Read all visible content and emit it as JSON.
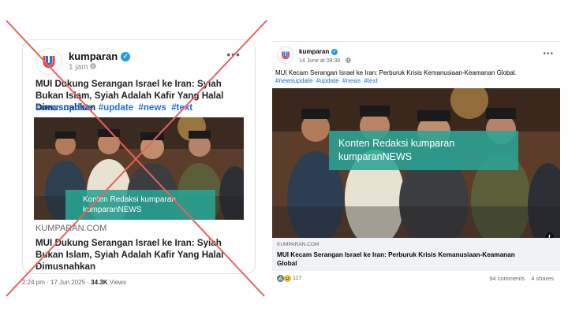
{
  "fake_post": {
    "account": "kumparan",
    "time": "1 jam",
    "headline": "MUI Dukung Serangan Israel ke Iran: Syiah Bukan Islam, Syiah Adalah Kafir Yang Halal Dimusnahkan",
    "hashtags": [
      "#newsupdate",
      "#update",
      "#news",
      "#text"
    ],
    "overlay_line1": "Konten Redaksi kumparan",
    "overlay_line2": "kumparanNEWS",
    "link_domain": "KUMPARAN.COM",
    "link_title": "MUI Dukung Serangan Israel ke Iran: Syiah Bukan Islam, Syiah Adalah Kafir Yang Halal Dimusnahkan",
    "footer_time": "2:24 pm · 17 Jun 2025 · ",
    "footer_views": "34.3K",
    "footer_views_label": " Views"
  },
  "real_post": {
    "account": "kumparan",
    "time": "14 June at 09:39 · ",
    "text": "MUI Kecam Serangan Israel ke Iran: Perburuk Krisis Kemanusiaan-Keamanan Global.",
    "hashtags": [
      "#newsupdate",
      "#update",
      "#news",
      "#text"
    ],
    "overlay_line1": "Konten Redaksi kumparan",
    "overlay_line2": "kumparanNEWS",
    "link_domain": "KUMPARAN.COM",
    "link_title": "MUI Kecam Serangan Israel ke Iran: Perburuk Krisis Kemanusiaan-Keamanan Global",
    "reactions_count": "117",
    "comments": "94 comments",
    "shares": "4 shares"
  },
  "colors": {
    "cross": "#e8615a",
    "link": "#216fdb",
    "overlay": "#29a494",
    "brand_red": "#e8423f",
    "brand_blue": "#2a6fd6"
  },
  "icons": [
    "kumparan-logo-icon",
    "verified-icon",
    "globe-icon",
    "more-icon",
    "like-reaction-icon",
    "haha-reaction-icon",
    "info-icon"
  ]
}
